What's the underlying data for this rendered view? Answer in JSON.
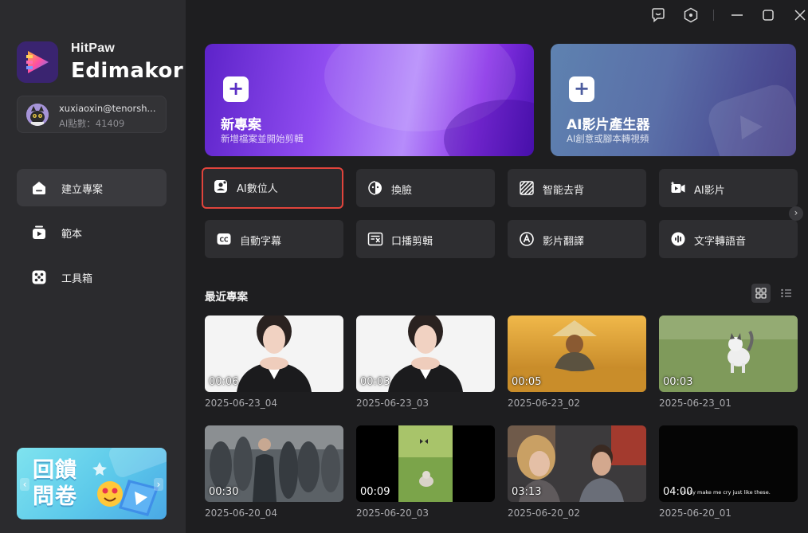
{
  "app": {
    "brand_line1": "HitPaw",
    "brand_line2": "Edimakor"
  },
  "account": {
    "email": "xuxiaoxin@tenorsh...",
    "credits": "AI點數：41409"
  },
  "nav": {
    "items": [
      {
        "label": "建立專案",
        "icon": "home-icon",
        "active": true
      },
      {
        "label": "範本",
        "icon": "template-icon",
        "active": false
      },
      {
        "label": "工具箱",
        "icon": "toolbox-icon",
        "active": false
      }
    ]
  },
  "survey": {
    "text": "回饋問卷",
    "prev_glyph": "‹",
    "next_glyph": "›"
  },
  "window_controls": {
    "icons": [
      "feedback-icon",
      "settings-icon",
      "minimize-icon",
      "maximize-icon",
      "close-icon"
    ]
  },
  "hero": {
    "new_project": {
      "plus": "+",
      "title": "新專案",
      "subtitle": "新增檔案並開始剪輯"
    },
    "ai_generator": {
      "plus": "+",
      "title": "AI影片產生器",
      "subtitle": "AI創意或腳本轉視頻"
    }
  },
  "tools": {
    "row1": [
      {
        "label": "AI數位人",
        "icon": "ai-avatar-icon",
        "highlighted": true
      },
      {
        "label": "換臉",
        "icon": "face-swap-icon",
        "highlighted": false
      },
      {
        "label": "智能去背",
        "icon": "background-remover-icon",
        "highlighted": false
      },
      {
        "label": "AI影片",
        "icon": "ai-video-icon",
        "highlighted": false
      }
    ],
    "row2": [
      {
        "label": "自動字幕",
        "icon": "subtitle-cc-icon",
        "highlighted": false
      },
      {
        "label": "口播剪輯",
        "icon": "speech-edit-icon",
        "highlighted": false
      },
      {
        "label": "影片翻譯",
        "icon": "translate-icon",
        "highlighted": false
      },
      {
        "label": "文字轉語音",
        "icon": "text-to-speech-icon",
        "highlighted": false
      }
    ],
    "next_glyph": "›"
  },
  "recent": {
    "title": "最近專案",
    "view_modes": [
      "grid-view-icon",
      "list-view-icon"
    ],
    "projects": [
      {
        "duration": "00:06",
        "name": "2025-06-23_04",
        "scene": "woman-portrait"
      },
      {
        "duration": "00:03",
        "name": "2025-06-23_03",
        "scene": "woman-portrait"
      },
      {
        "duration": "00:05",
        "name": "2025-06-23_02",
        "scene": "wheat-field-farmer"
      },
      {
        "duration": "00:03",
        "name": "2025-06-23_01",
        "scene": "kitten-grass"
      },
      {
        "duration": "00:30",
        "name": "2025-06-20_04",
        "scene": "crowd-street"
      },
      {
        "duration": "00:09",
        "name": "2025-06-20_03",
        "scene": "cat-butterfly"
      },
      {
        "duration": "03:13",
        "name": "2025-06-20_02",
        "scene": "two-people-car"
      },
      {
        "duration": "04:00",
        "name": "2025-06-20_01",
        "scene": "black-frame",
        "caption": "really make me cry just like these."
      }
    ]
  },
  "colors": {
    "sidebar_bg": "#2b2b2e",
    "main_bg": "#1e1e20",
    "highlight_border": "#e0443c",
    "accent_purple": "#8f4cf0"
  }
}
